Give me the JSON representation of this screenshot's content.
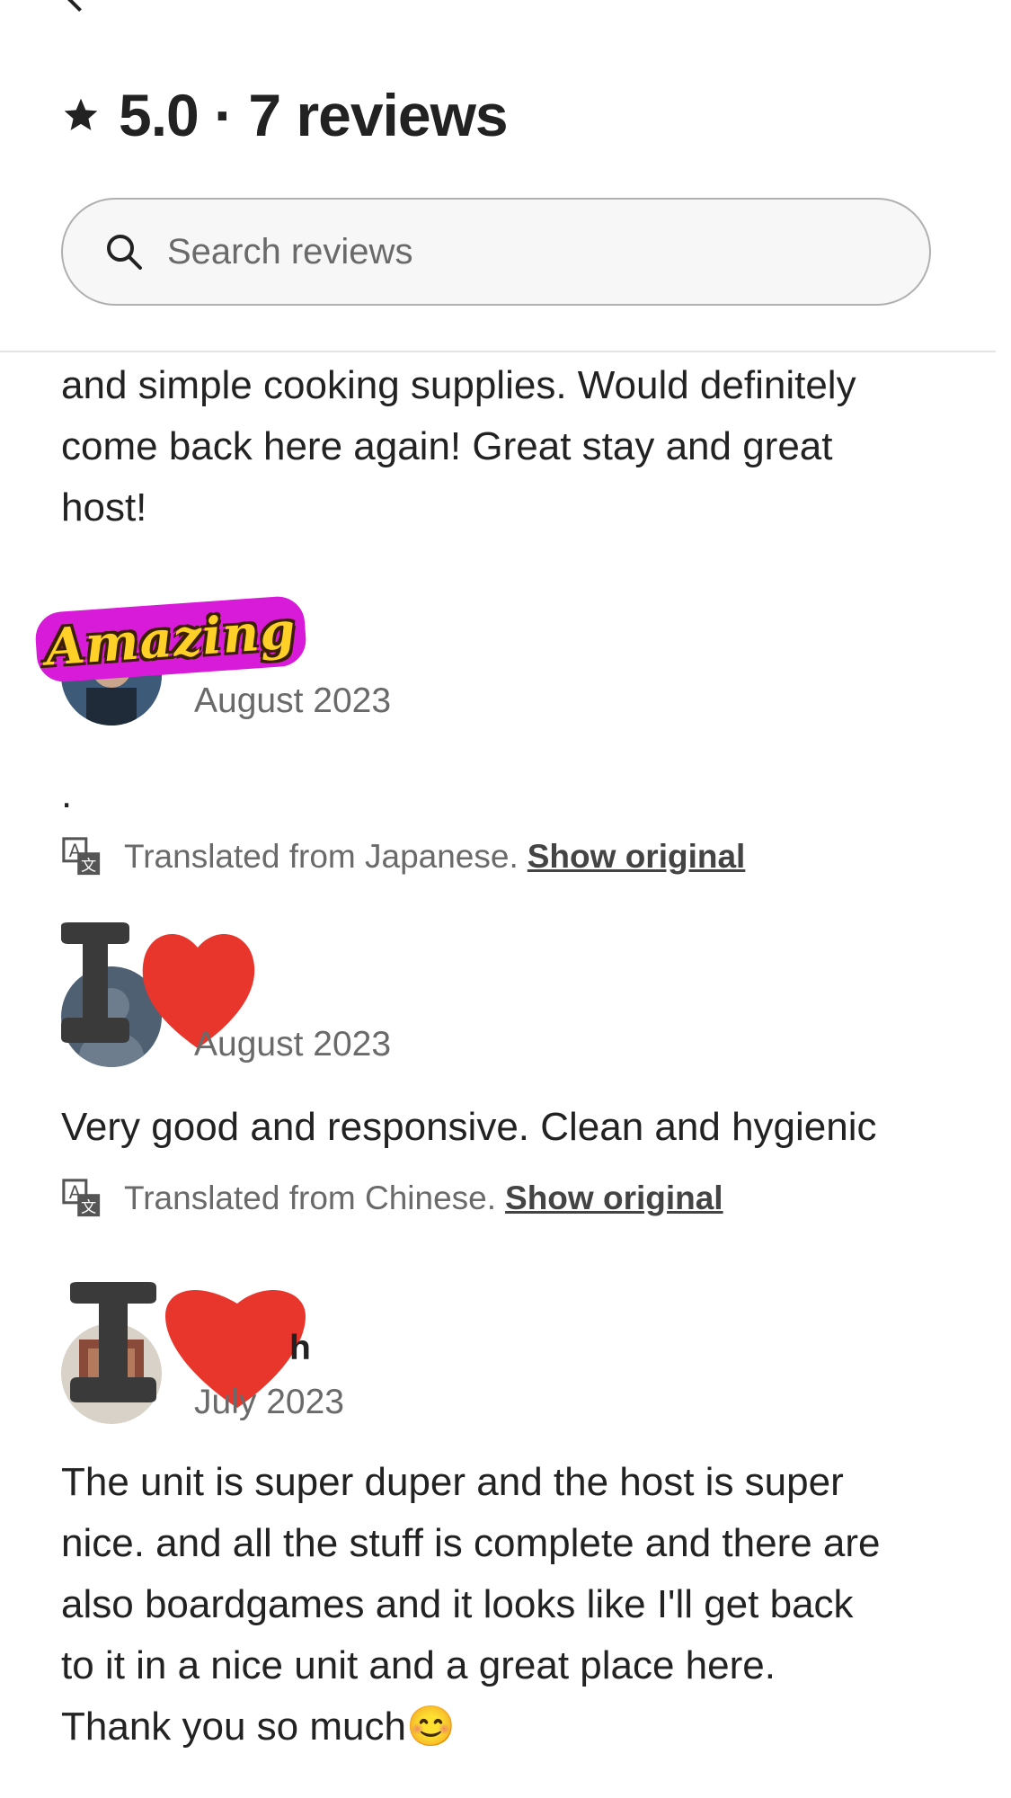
{
  "header": {
    "title": "5.0 · 7 reviews",
    "star_icon": "star-icon"
  },
  "search": {
    "placeholder": "Search reviews"
  },
  "reviews": [
    {
      "text_lines": [
        "and simple cooking supplies. Would definitely",
        "come back here again! Great stay and great",
        "host!"
      ]
    },
    {
      "date": "August 2023",
      "text": ".",
      "sticker": "Amazing",
      "translation": {
        "label": "Translated from Japanese.",
        "link": "Show original"
      }
    },
    {
      "date": "August 2023",
      "text": "Very good and responsive. Clean and hygienic",
      "sticker": "I ❤",
      "translation": {
        "label": "Translated from Chinese.",
        "link": "Show original"
      }
    },
    {
      "name_partial": "h",
      "date": "July 2023",
      "sticker": "I ❤",
      "text_lines": [
        "The unit is super duper and the host is super",
        "nice. and all the stuff is complete and there are",
        "also boardgames and it looks like I'll get back",
        "to it in a nice unit and a great place here.",
        "Thank you so much😊"
      ]
    }
  ],
  "colors": {
    "heart": "#e8362d",
    "text": "#222222",
    "muted": "#6a6a6a",
    "sticker_pink": "#d81bd8",
    "sticker_yellow": "#ffd028"
  }
}
